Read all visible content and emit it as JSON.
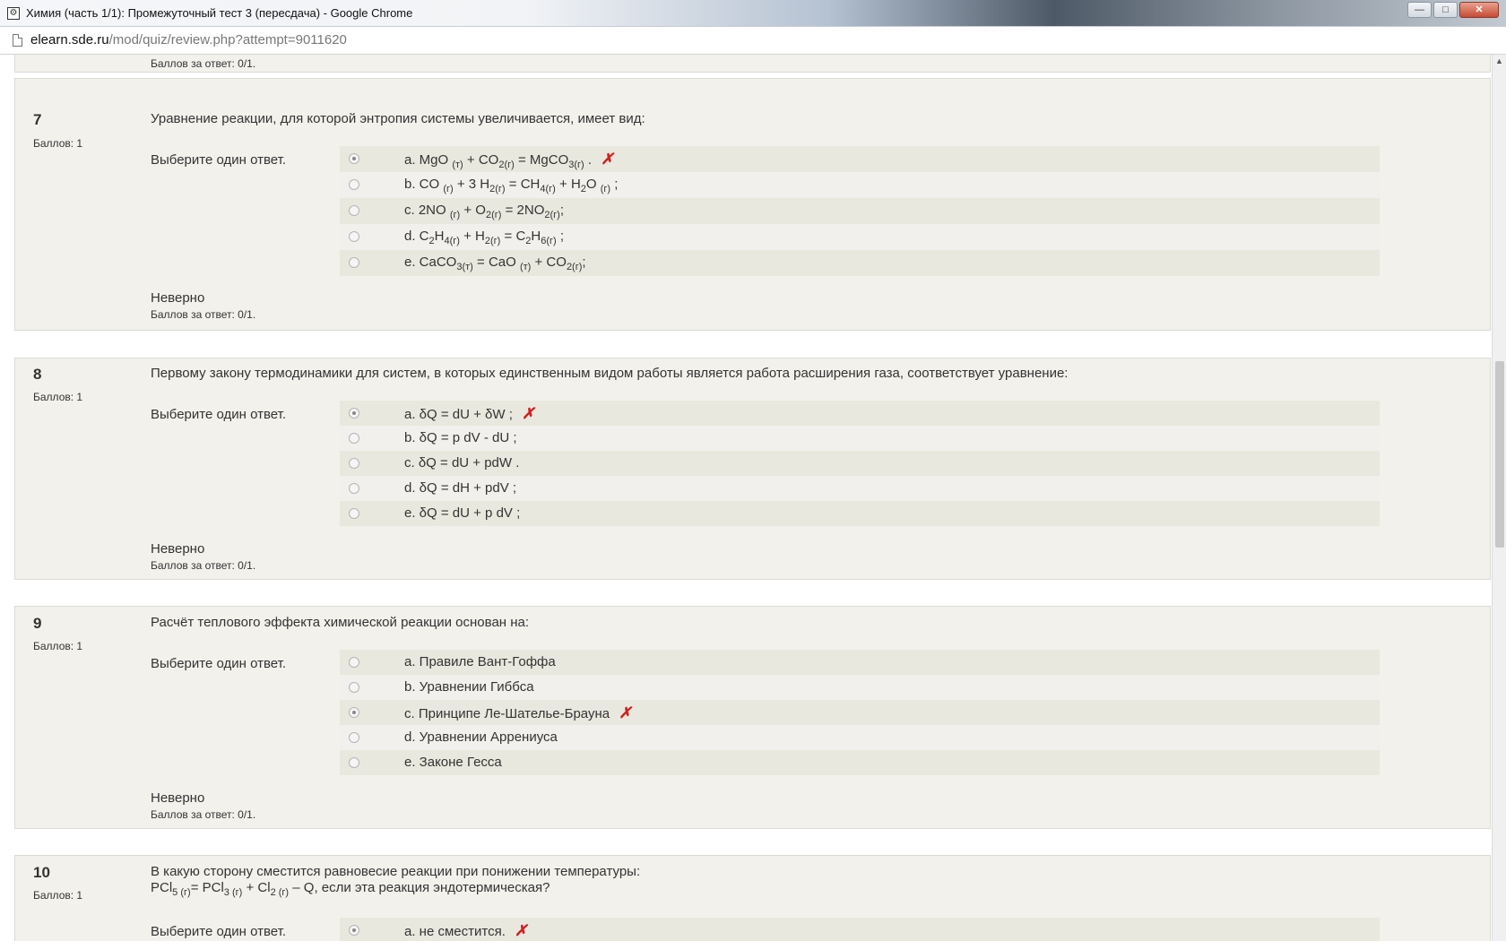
{
  "window": {
    "title": "Химия (часть 1/1): Промежуточный тест 3 (пересдача) - Google Chrome",
    "minimize": "—",
    "maximize": "□",
    "close": "✕"
  },
  "address": {
    "host": "elearn.sde.ru",
    "path": "/mod/quiz/review.php?attempt=9011620"
  },
  "prev_question": {
    "score": "Баллов за ответ: 0/1."
  },
  "questions": [
    {
      "number": "7",
      "mark": "Баллов: 1",
      "text": "Уравнение реакции, для которой энтропия системы увеличивается, имеет вид:",
      "prompt": "Выберите один ответ.",
      "state": "Неверно",
      "score": "Баллов за ответ: 0/1."
    },
    {
      "number": "8",
      "mark": "Баллов: 1",
      "text": "Первому закону термодинамики для систем, в которых единственным видом работы является работа расширения газа, соответствует уравнение:",
      "prompt": "Выберите один ответ.",
      "state": "Неверно",
      "score": "Баллов за ответ: 0/1.",
      "answers": [
        "a. δQ = dU + δW ;",
        "b. δQ = p dV - dU ;",
        "c. δQ = dU + pdW .",
        "d. δQ = dH + pdV ;",
        "e. δQ = dU + p dV ;"
      ]
    },
    {
      "number": "9",
      "mark": "Баллов: 1",
      "text": "Расчёт теплового эффекта химической реакции основан на:",
      "prompt": "Выберите один ответ.",
      "state": "Неверно",
      "score": "Баллов за ответ: 0/1.",
      "answers": [
        "a. Правиле Вант-Гоффа",
        "b. Уравнении Гиббса",
        "c. Принципе Ле-Шателье-Брауна",
        "d. Уравнении Аррениуса",
        "e. Законе Гесса"
      ]
    },
    {
      "number": "10",
      "mark": "Баллов: 1",
      "text": "В какую сторону сместится равновесие реакции при понижении температуры:",
      "prompt": "Выберите один ответ.",
      "answers": [
        "a. не сместится."
      ]
    }
  ],
  "icons": {
    "wrong": "✗",
    "wrong_color": "#d21f1f"
  },
  "colors": {
    "question_bg": "#f2f1ec",
    "answer_row_odd": "#e9e8de",
    "answer_row_even": "#f1f0ec"
  }
}
